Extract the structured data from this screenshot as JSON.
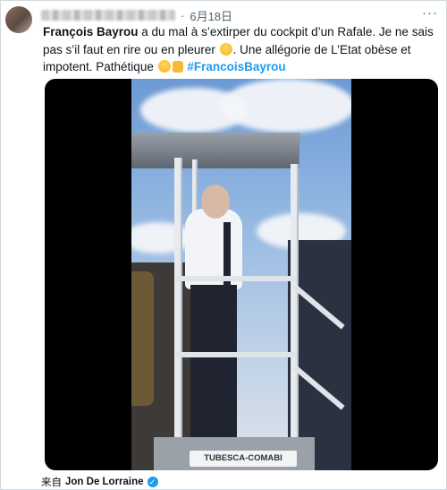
{
  "post": {
    "date": "6月18日",
    "author": "François Bayrou",
    "text_1": " a du mal à s’extirper du cockpit d’un Rafale. Je ne sais pas s’il faut en rire ou en pleurer ",
    "text_2": ". Une allégorie de L’Etat obèse et impotent. Pathétique ",
    "hashtag": "#FrancoisBayrou",
    "more_label": "···",
    "separator": "·"
  },
  "media": {
    "brand_text": "TUBESCA-COMABI"
  },
  "footer": {
    "source_prefix": "来自",
    "source_name": "Jon De Lorraine",
    "verified_mark": "✓"
  }
}
